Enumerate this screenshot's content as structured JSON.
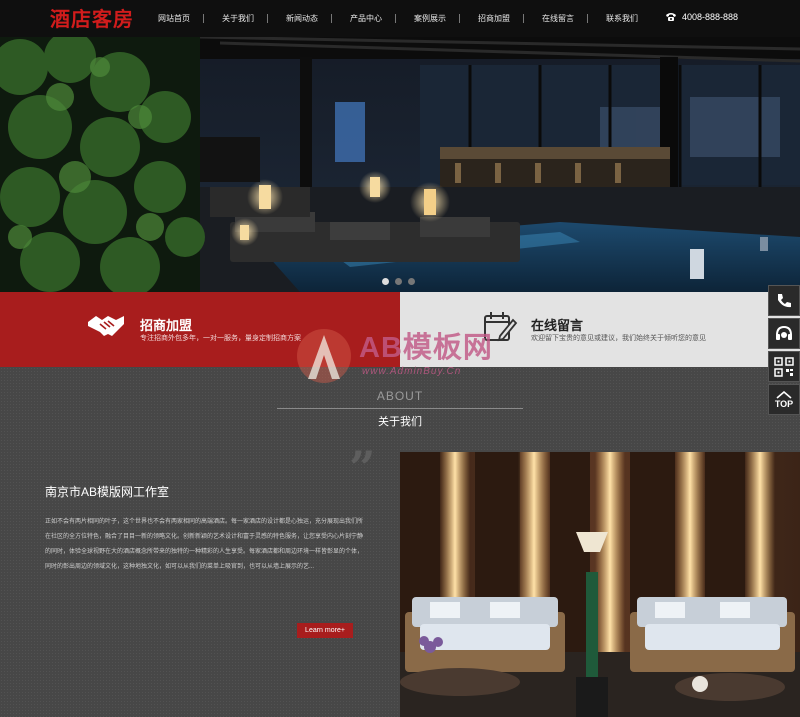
{
  "header": {
    "logo": "酒店客房",
    "nav": [
      "网站首页",
      "关于我们",
      "新闻动态",
      "产品中心",
      "案例展示",
      "招商加盟",
      "在线留言",
      "联系我们"
    ],
    "phone": "4008-888-888"
  },
  "banner": {
    "active_slide_index": 0,
    "slide_count": 3
  },
  "cta": {
    "left": {
      "title": "招商加盟",
      "subtitle": "专注招商外包多年，一对一服务，量身定制招商方案",
      "icon": "handshake-icon"
    },
    "right": {
      "title": "在线留言",
      "subtitle": "欢迎留下宝贵的意见或建议，我们始终关于倾听您的意见",
      "icon": "calendar-edit-icon"
    }
  },
  "about": {
    "title_en": "ABOUT",
    "title_cn": "关于我们",
    "company": "南京市AB模版网工作室",
    "description": "正如不会有两片相同的叶子，这个世界也不会有两家相同的高端酒店。每一家酒店的设计都是心独运，充分展现出我们所在社区的全方位特色，融合了目目一新的领略文化。创新新颖的艺术设计和富于灵感的特色服务，让您享受内心片刻宁静的同时，体验全球视野在大的酒店概念所带来的独特的一种精彩的人生享受。每家酒店都和周边环境一样皆彰显的个体，同时的彰出周边的领域文化，这种地独文化，如可以从我们的菜单上吸官到，也可以从墙上展示的艺...",
    "more_label": "Learn more+"
  },
  "watermark": {
    "text": "AB模板网",
    "url": "www.AdminBuy.Cn"
  },
  "sidebar": {
    "items": [
      "phone-icon",
      "customer-service-icon",
      "qrcode-icon"
    ],
    "top_label": "TOP"
  }
}
